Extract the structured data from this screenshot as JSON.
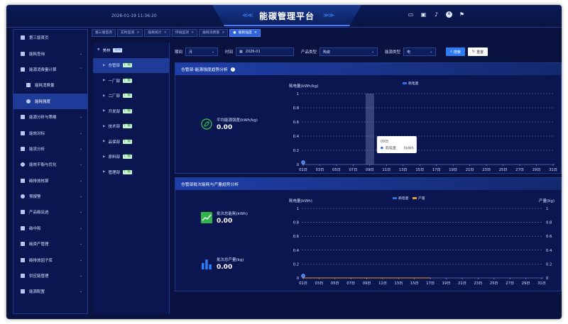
{
  "header": {
    "datetime": "2026-01-19 11:36:20",
    "title": "能碳管理平台",
    "chevrons_left": "≪≪",
    "chevrons_right": "≫≫",
    "avatar_text": "A"
  },
  "sidebar": {
    "items": [
      {
        "label": "第三版首页",
        "arrow": ""
      },
      {
        "label": "能耗查询",
        "arrow": "⌄"
      },
      {
        "label": "能源消费量计算",
        "arrow": "⌃"
      },
      {
        "label": "能耗消费量",
        "arrow": ""
      },
      {
        "label": "能耗强度",
        "arrow": ""
      },
      {
        "label": "能源分析与策略",
        "arrow": "⌄"
      },
      {
        "label": "能效对标",
        "arrow": "⌄"
      },
      {
        "label": "能流分析",
        "arrow": "⌄"
      },
      {
        "label": "能效平衡与优化",
        "arrow": "⌄"
      },
      {
        "label": "碳排放核算",
        "arrow": "⌄"
      },
      {
        "label": "预报警",
        "arrow": "⌄"
      },
      {
        "label": "产品碳足迹",
        "arrow": "⌄"
      },
      {
        "label": "碳中和",
        "arrow": "⌄"
      },
      {
        "label": "碳资产管理",
        "arrow": "⌄"
      },
      {
        "label": "碳排放因子库",
        "arrow": "⌄"
      },
      {
        "label": "供应链管理",
        "arrow": "⌄"
      },
      {
        "label": "能源配置",
        "arrow": "⌄"
      }
    ]
  },
  "tabs": [
    {
      "label": "第三版首页"
    },
    {
      "label": "实时监测"
    },
    {
      "label": "能耗统计"
    },
    {
      "label": "环境监测"
    },
    {
      "label": "能耗消费量"
    },
    {
      "label": "能耗强度"
    }
  ],
  "tree": {
    "root": {
      "label": "美林",
      "tag": "公司"
    },
    "children": [
      {
        "label": "仓管部",
        "tag": "厂级"
      },
      {
        "label": "一厂部",
        "tag": "厂级"
      },
      {
        "label": "二厂部",
        "tag": "厂级"
      },
      {
        "label": "开发部",
        "tag": "厂级"
      },
      {
        "label": "技术部",
        "tag": "厂级"
      },
      {
        "label": "品保部",
        "tag": "厂级"
      },
      {
        "label": "原料部",
        "tag": "厂级"
      },
      {
        "label": "管理部",
        "tag": "厂级"
      }
    ]
  },
  "filters": {
    "period_label": "期间",
    "period_value": "月",
    "time_label": "时间",
    "time_value": "2026-01",
    "product_label": "产品类型",
    "product_value": "陶瓷",
    "energy_label": "能源类型",
    "energy_value": "电",
    "search_label": "搜索",
    "reset_label": "重置"
  },
  "panel1": {
    "title": "仓管部-能源强度趋势分析",
    "kpi_label": "平均能源强度(kWh/kg)",
    "kpi_value": "0.00",
    "tooltip": {
      "date": "09日",
      "series": "耗电量",
      "value": "0kWh"
    }
  },
  "panel2": {
    "title": "仓管部批次能耗与产量趋势分析",
    "kpi1_label": "批次总能耗(kWh)",
    "kpi1_value": "0.00",
    "kpi2_label": "批次总产量(kg)",
    "kpi2_value": "0.00"
  },
  "colors": {
    "energy": "#2f6fe0",
    "output": "#e89a2a",
    "kpi_green": "#2fb54a",
    "kpi_blue": "#2f7df6"
  },
  "chart_data": [
    {
      "type": "line",
      "ylabel": "耗电量(kWh/kg)",
      "ylim": [
        0,
        1
      ],
      "yticks": [
        "0",
        "0.2",
        "0.4",
        "0.6",
        "0.8",
        "1"
      ],
      "x": [
        "01日",
        "03日",
        "05日",
        "07日",
        "09日",
        "11日",
        "13日",
        "15日",
        "17日",
        "19日",
        "21日",
        "23日",
        "25日",
        "27日",
        "29日",
        "31日"
      ],
      "series": [
        {
          "name": "耗电量",
          "values": [
            0
          ]
        }
      ],
      "legend": "top-center",
      "grid": true
    },
    {
      "type": "line",
      "ylabel": "耗电量(kWh)",
      "y2label": "产量(kg)",
      "ylim": [
        0,
        1
      ],
      "y2lim": [
        0,
        1
      ],
      "yticks": [
        "0",
        "0.2",
        "0.4",
        "0.6",
        "0.8",
        "1"
      ],
      "y2ticks": [
        "0",
        "0.2",
        "0.4",
        "0.6",
        "0.8",
        "1"
      ],
      "x": [
        "01日",
        "03日",
        "05日",
        "07日",
        "09日",
        "11日",
        "13日",
        "15日",
        "17日",
        "19日",
        "21日",
        "23日",
        "25日",
        "27日",
        "29日",
        "31日"
      ],
      "series": [
        {
          "name": "耗电量",
          "values": [
            0
          ]
        },
        {
          "name": "产量",
          "values": [
            0,
            0,
            0,
            0,
            0,
            0,
            0,
            0,
            0
          ]
        }
      ],
      "legend": "top-center",
      "grid": true
    }
  ]
}
